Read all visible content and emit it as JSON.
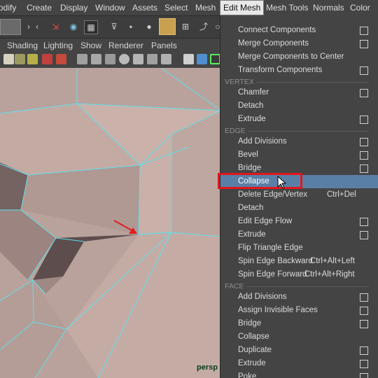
{
  "menubar": {
    "items": [
      "odify",
      "Create",
      "Display",
      "Window",
      "Assets",
      "Select",
      "Mesh",
      "Edit Mesh",
      "Mesh Tools",
      "Normals",
      "Color"
    ]
  },
  "panel_menu": {
    "items": [
      "Shading",
      "Lighting",
      "Show",
      "Renderer",
      "Panels"
    ]
  },
  "viewport": {
    "camera_label": "persp",
    "mesh_color": "#b9a29c",
    "wire_color": "#5fe0ee",
    "arrow_color": "#e0201e"
  },
  "edit_mesh_menu": {
    "top_items": [
      {
        "label": "Connect Components",
        "option": true
      },
      {
        "label": "Merge Components",
        "option": true
      },
      {
        "label": "Merge Components to Center",
        "option": false
      },
      {
        "label": "Transform Components",
        "option": true
      }
    ],
    "vertex_header": "VERTEX",
    "vertex_items": [
      {
        "label": "Chamfer",
        "option": true
      },
      {
        "label": "Detach",
        "option": false
      },
      {
        "label": "Extrude",
        "option": true
      }
    ],
    "edge_header": "EDGE",
    "edge_items": [
      {
        "label": "Add Divisions",
        "option": true
      },
      {
        "label": "Bevel",
        "option": true
      },
      {
        "label": "Bridge",
        "option": true
      },
      {
        "label": "Collapse",
        "option": false,
        "highlighted": true
      },
      {
        "label": "Delete Edge/Vertex",
        "option": false,
        "shortcut": "Ctrl+Del"
      },
      {
        "label": "Detach",
        "option": false
      },
      {
        "label": "Edit Edge Flow",
        "option": true
      },
      {
        "label": "Extrude",
        "option": true
      },
      {
        "label": "Flip Triangle Edge",
        "option": false
      },
      {
        "label": "Spin Edge Backward",
        "option": false,
        "shortcut": "Ctrl+Alt+Left"
      },
      {
        "label": "Spin Edge Forward",
        "option": false,
        "shortcut": "Ctrl+Alt+Right"
      }
    ],
    "face_header": "FACE",
    "face_items": [
      {
        "label": "Add Divisions",
        "option": true
      },
      {
        "label": "Assign Invisible Faces",
        "option": true
      },
      {
        "label": "Bridge",
        "option": true
      },
      {
        "label": "Collapse",
        "option": false
      },
      {
        "label": "Duplicate",
        "option": true
      },
      {
        "label": "Extrude",
        "option": true
      },
      {
        "label": "Poke",
        "option": true
      }
    ],
    "highlight_color": "#5a7fa6",
    "callout_color": "#e2161e"
  }
}
